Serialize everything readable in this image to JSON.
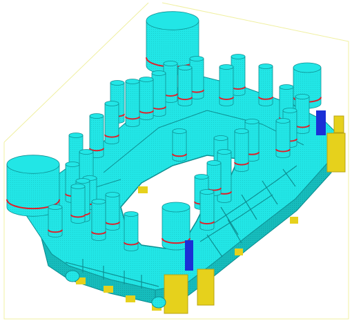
{
  "scene": {
    "background": "#ffffff",
    "body_color": "#22e6e6",
    "body_shadow": "#14b8b8",
    "body_dark": "#0e8f92",
    "band_color": "#e0202a",
    "pad_color": "#e6d11c",
    "pad_shadow": "#b8a410",
    "clamp_color": "#1a2fd6",
    "bbox_color": "#f0f0a0",
    "risers": {
      "large_count": 4,
      "small_count": 34
    }
  }
}
